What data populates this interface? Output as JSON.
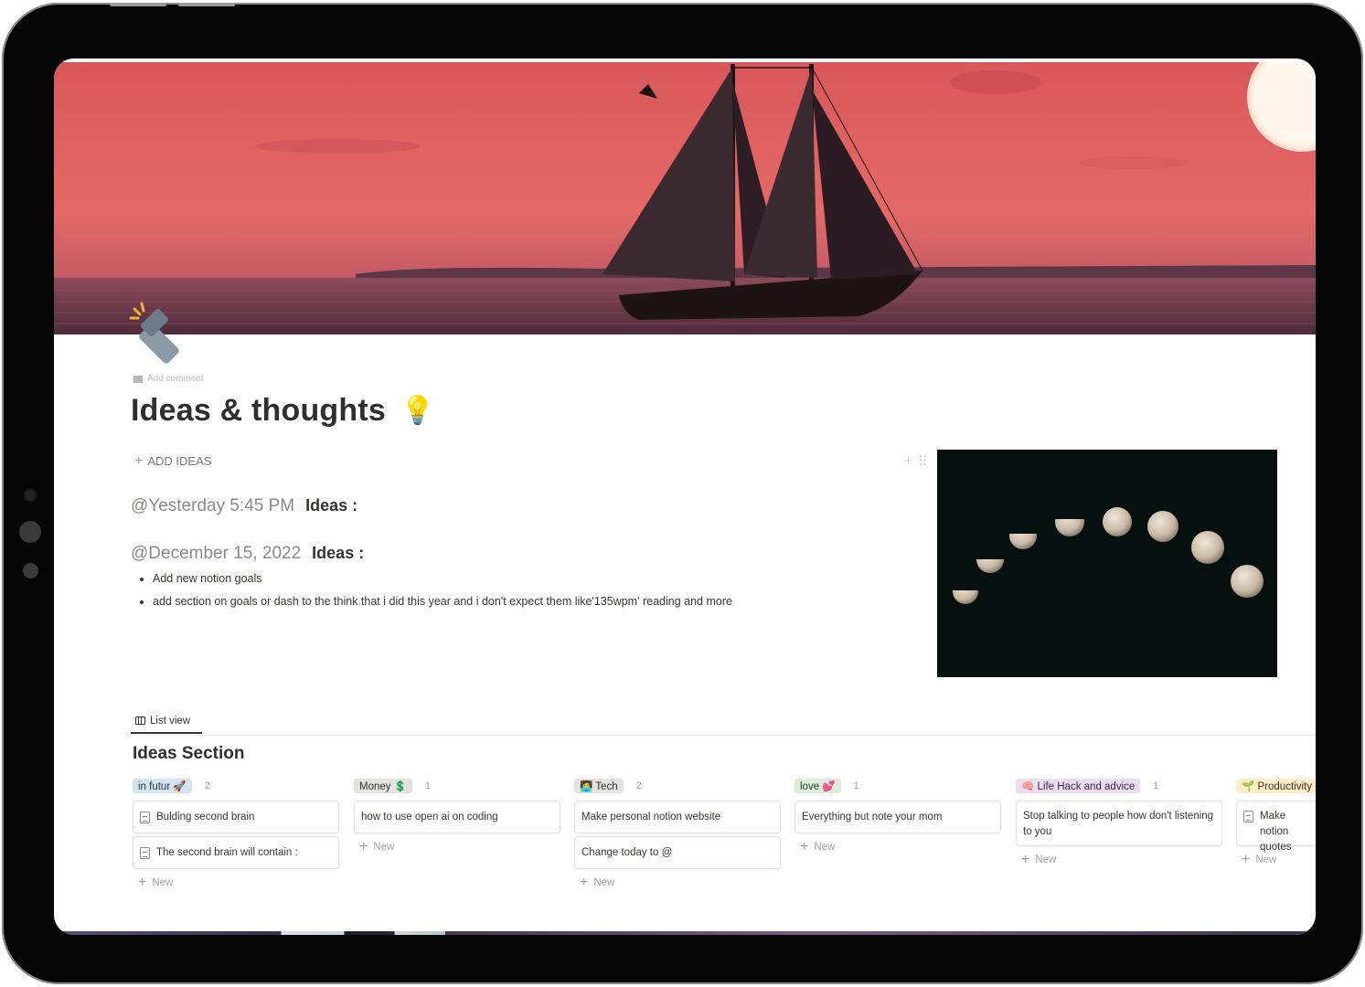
{
  "page": {
    "comment_label": "Add comment",
    "title": "Ideas & thoughts",
    "title_emoji": "💡",
    "add_ideas_label": "ADD IDEAS",
    "entries": [
      {
        "date": "@Yesterday 5:45 PM",
        "label": "Ideas :"
      },
      {
        "date": "@December 15, 2022",
        "label": "Ideas :"
      }
    ],
    "bullets": [
      "Add new notion goals",
      "add section on goals or dash to the think that i did this year and i don't expect them like'135wpm' reading and more"
    ]
  },
  "database": {
    "view_tab": "List view",
    "section_title": "Ideas Section",
    "new_label": "New",
    "groups": [
      {
        "tag": "in futur 🚀",
        "count": "2",
        "tag_bg": "#d3e5ef",
        "tag_color": "#183347",
        "cards": [
          "Bulding second brain",
          "The second brain will contain :"
        ],
        "card_icons": true
      },
      {
        "tag": "Money 💲",
        "count": "1",
        "tag_bg": "#e3e2e0",
        "tag_color": "#32302c",
        "cards": [
          "how to use open ai on coding"
        ],
        "card_icons": false
      },
      {
        "tag": "🧑‍💻 Tech",
        "count": "2",
        "tag_bg": "#e3e2e0",
        "tag_color": "#32302c",
        "cards": [
          "Make personal notion website",
          "Change today to @"
        ],
        "card_icons": false
      },
      {
        "tag": "love 💕",
        "count": "1",
        "tag_bg": "#dbeddb",
        "tag_color": "#1c3829",
        "cards": [
          "Everything but note your mom"
        ],
        "card_icons": false
      },
      {
        "tag": "🧠 Life Hack and advice",
        "count": "1",
        "tag_bg": "#e8deee",
        "tag_color": "#412454",
        "cards": [
          "Stop talking to people how don't listening to you"
        ],
        "card_icons": false
      },
      {
        "tag": "🌱 Productivity",
        "count": "",
        "tag_bg": "#fdecc8",
        "tag_color": "#402c1b",
        "cards": [
          "Make notion quotes"
        ],
        "card_icons": true
      }
    ]
  },
  "icons": {
    "page_icon": "flashlight-icon",
    "cover": "sailboat-sunset-image",
    "embed": "moon-phases-image"
  }
}
